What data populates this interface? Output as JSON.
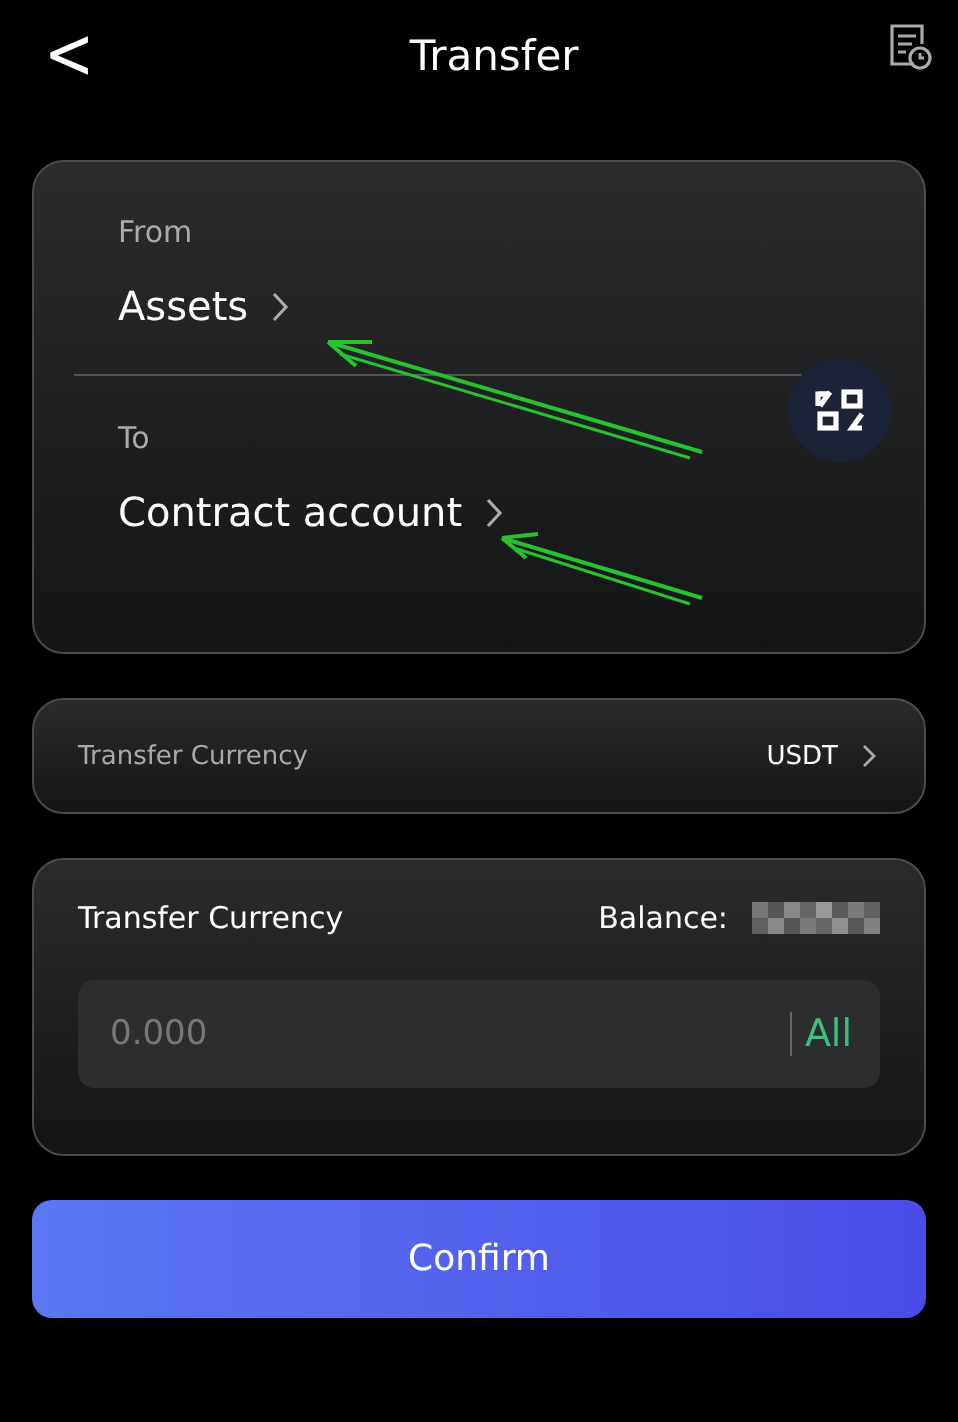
{
  "header": {
    "back": "<",
    "title": "Transfer"
  },
  "route": {
    "from": {
      "label": "From",
      "value": "Assets"
    },
    "to": {
      "label": "To",
      "value": "Contract account"
    }
  },
  "currency": {
    "label": "Transfer Currency",
    "value": "USDT"
  },
  "amount": {
    "label": "Transfer Currency",
    "balance_label": "Balance:",
    "placeholder": "0.000",
    "all": "All"
  },
  "confirm": "Confirm"
}
